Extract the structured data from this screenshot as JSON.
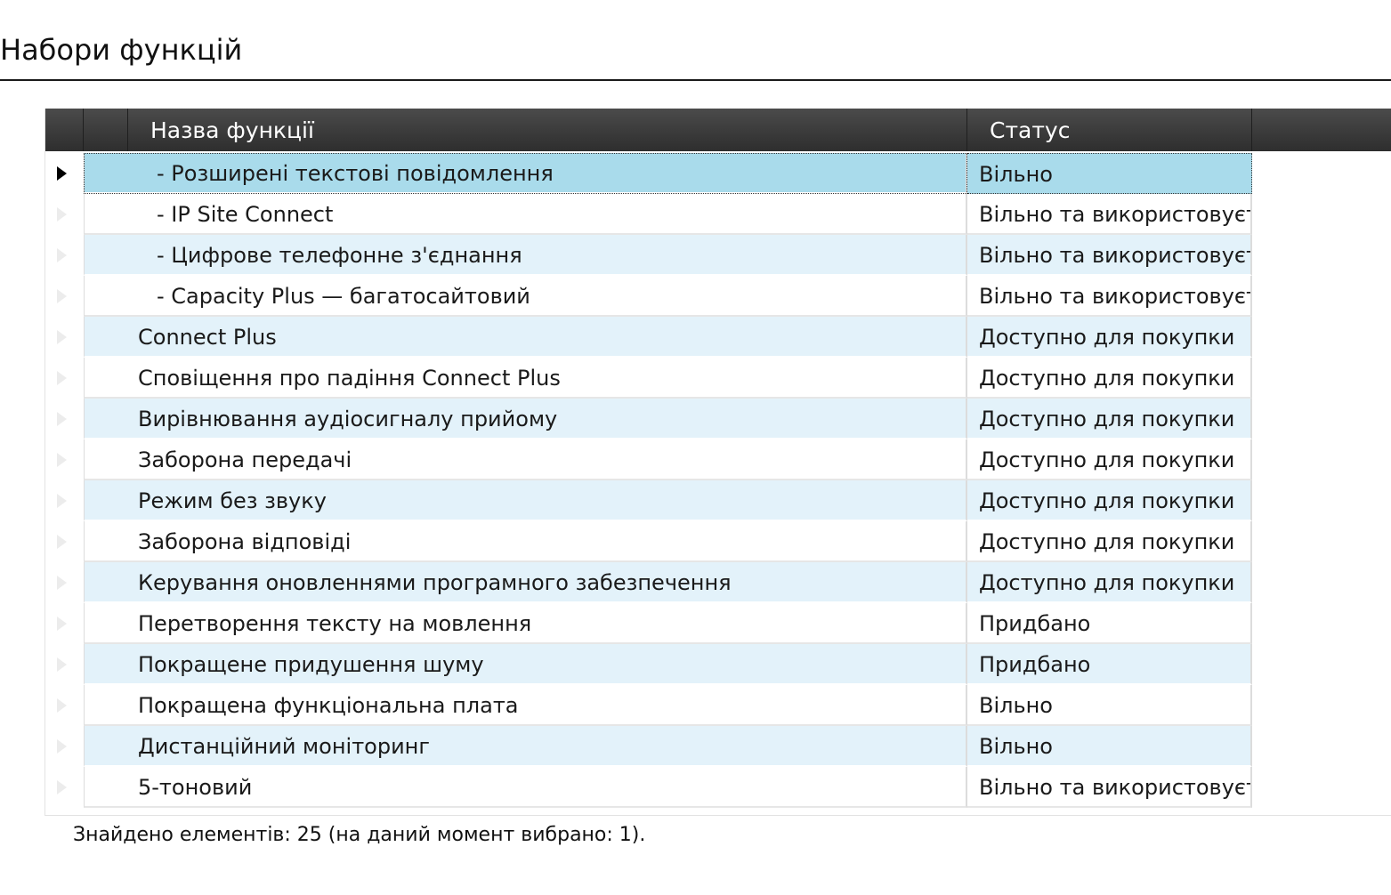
{
  "page": {
    "title": "Набори функцій"
  },
  "grid": {
    "columns": {
      "name": "Назва функції",
      "status": "Статус"
    },
    "rows": [
      {
        "name": "- Розширені текстові повідомлення",
        "status": "Вільно",
        "child": true,
        "selected": true
      },
      {
        "name": "- IP Site Connect",
        "status": "Вільно та використовується",
        "child": true,
        "selected": false
      },
      {
        "name": "- Цифрове телефонне з'єднання",
        "status": "Вільно та використовується",
        "child": true,
        "selected": false
      },
      {
        "name": "- Capacity Plus — багатосайтовий",
        "status": "Вільно та використовується",
        "child": true,
        "selected": false
      },
      {
        "name": "Connect Plus",
        "status": "Доступно для покупки",
        "child": false,
        "selected": false
      },
      {
        "name": "Сповіщення про падіння Connect Plus",
        "status": "Доступно для покупки",
        "child": false,
        "selected": false
      },
      {
        "name": "Вирівнювання аудіосигналу прийому",
        "status": "Доступно для покупки",
        "child": false,
        "selected": false
      },
      {
        "name": "Заборона передачі",
        "status": "Доступно для покупки",
        "child": false,
        "selected": false
      },
      {
        "name": "Режим без звуку",
        "status": "Доступно для покупки",
        "child": false,
        "selected": false
      },
      {
        "name": "Заборона відповіді",
        "status": "Доступно для покупки",
        "child": false,
        "selected": false
      },
      {
        "name": "Керування оновленнями програмного забезпечення",
        "status": "Доступно для покупки",
        "child": false,
        "selected": false
      },
      {
        "name": "Перетворення тексту на мовлення",
        "status": "Придбано",
        "child": false,
        "selected": false
      },
      {
        "name": "Покращене придушення шуму",
        "status": "Придбано",
        "child": false,
        "selected": false
      },
      {
        "name": "Покращена функціональна плата",
        "status": "Вільно",
        "child": false,
        "selected": false
      },
      {
        "name": "Дистанційний моніторинг",
        "status": "Вільно",
        "child": false,
        "selected": false
      },
      {
        "name": "5-тоновий",
        "status": "Вільно та використовується",
        "child": false,
        "selected": false
      }
    ]
  },
  "footer": {
    "status_text": "Знайдено елементів: 25 (на даний момент вибрано: 1)."
  },
  "colors": {
    "header_bg": "#3a3a3a",
    "selected_row": "#a9dbeb",
    "alt_row": "#e3f2fa"
  }
}
